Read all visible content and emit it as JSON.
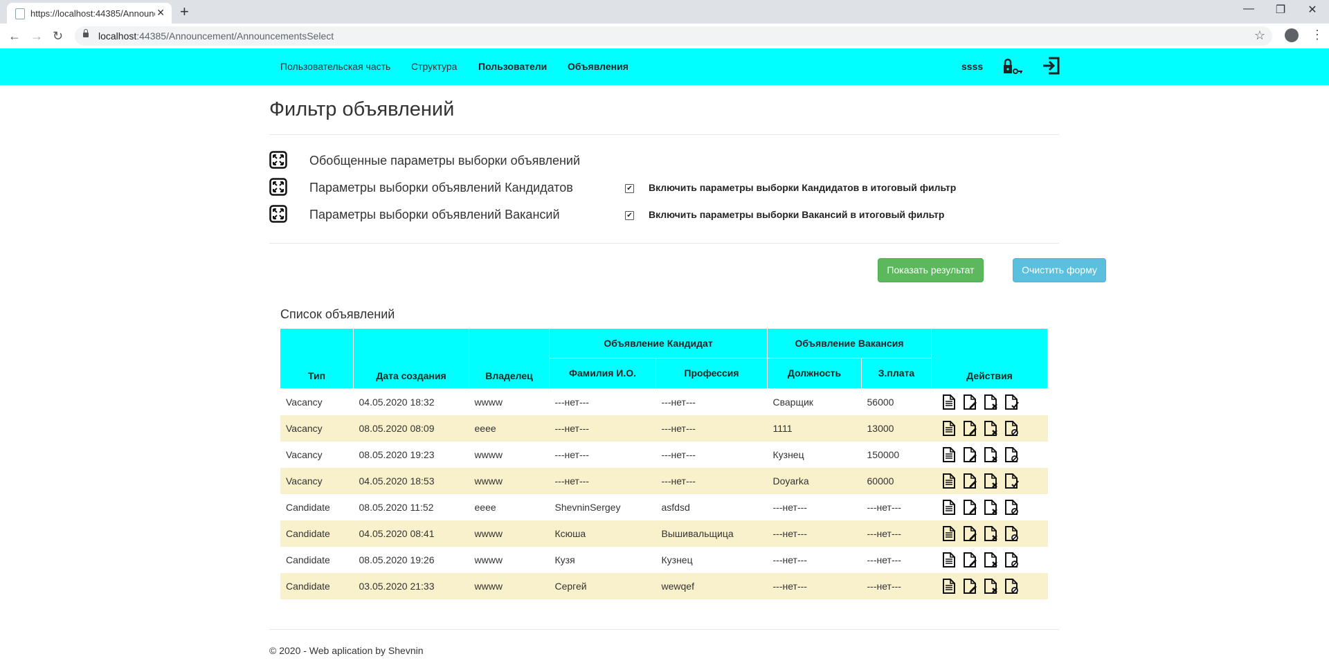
{
  "browser": {
    "tab_title": "https://localhost:44385/Announc",
    "url_host": "localhost",
    "url_rest": ":44385/Announcement/AnnouncementsSelect"
  },
  "navbar": {
    "links": [
      "Пользовательская часть",
      "Структура",
      "Пользователи",
      "Объявления"
    ],
    "user": "ssss"
  },
  "page": {
    "title": "Фильтр объявлений",
    "sections": [
      "Обобщенные параметры выборки объявлений",
      "Параметры выборки объявлений Кандидатов",
      "Параметры выборки объявлений Вакансий"
    ],
    "checkboxes": [
      {
        "label": "Включить параметры выборки Кандидатов в итоговый фильтр",
        "checked": true
      },
      {
        "label": "Включить параметры выборки Вакансий в итоговый фильтр",
        "checked": true
      }
    ],
    "buttons": {
      "show": "Показать результат",
      "clear": "Очистить форму"
    },
    "list_title": "Список объявлений"
  },
  "table": {
    "headers": {
      "type": "Тип",
      "created": "Дата создания",
      "owner": "Владелец",
      "candidate_group": "Объявление Кандидат",
      "vacancy_group": "Объявление Вакансия",
      "fio": "Фамилия И.О.",
      "profession": "Профессия",
      "position": "Должность",
      "salary": "З.плата",
      "actions": "Действия"
    },
    "rows": [
      {
        "type": "Vacancy",
        "created": "04.05.2020 18:32",
        "owner": "wwww",
        "fio": "---нет---",
        "profession": "---нет---",
        "position": "Сварщик",
        "salary": "56000",
        "status": "check"
      },
      {
        "type": "Vacancy",
        "created": "08.05.2020 08:09",
        "owner": "eeee",
        "fio": "---нет---",
        "profession": "---нет---",
        "position": "1111",
        "salary": "13000",
        "status": "block"
      },
      {
        "type": "Vacancy",
        "created": "08.05.2020 19:23",
        "owner": "wwww",
        "fio": "---нет---",
        "profession": "---нет---",
        "position": "Кузнец",
        "salary": "150000",
        "status": "block"
      },
      {
        "type": "Vacancy",
        "created": "04.05.2020 18:53",
        "owner": "wwww",
        "fio": "---нет---",
        "profession": "---нет---",
        "position": "Doyarka",
        "salary": "60000",
        "status": "check"
      },
      {
        "type": "Candidate",
        "created": "08.05.2020 11:52",
        "owner": "eeee",
        "fio": "ShevninSergey",
        "profession": "asfdsd",
        "position": "---нет---",
        "salary": "---нет---",
        "status": "block"
      },
      {
        "type": "Candidate",
        "created": "04.05.2020 08:41",
        "owner": "wwww",
        "fio": "Ксюша",
        "profession": "Вышивальщица",
        "position": "---нет---",
        "salary": "---нет---",
        "status": "block"
      },
      {
        "type": "Candidate",
        "created": "08.05.2020 19:26",
        "owner": "wwww",
        "fio": "Кузя",
        "profession": "Кузнец",
        "position": "---нет---",
        "salary": "---нет---",
        "status": "block"
      },
      {
        "type": "Candidate",
        "created": "03.05.2020 21:33",
        "owner": "wwww",
        "fio": "Сергей",
        "profession": "wewqef",
        "position": "---нет---",
        "salary": "---нет---",
        "status": "block"
      }
    ]
  },
  "footer": "© 2020 - Web aplication by Shevnin"
}
